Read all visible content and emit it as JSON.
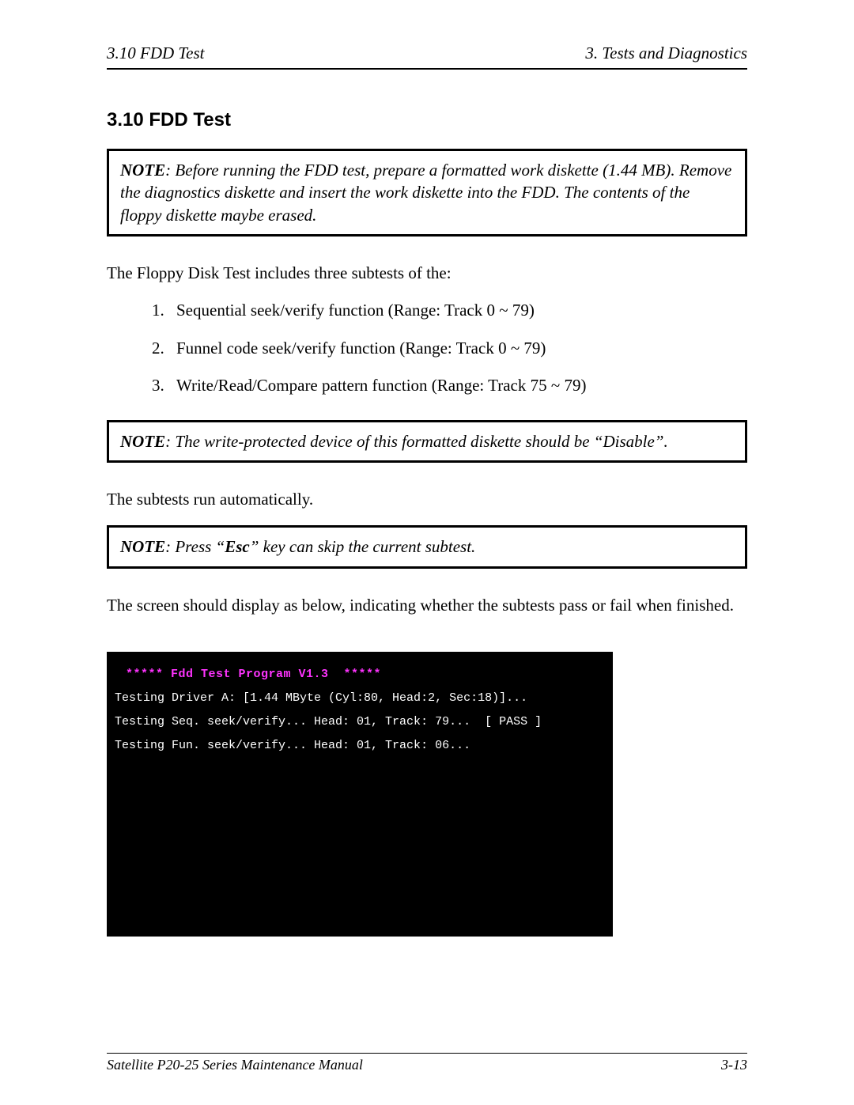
{
  "header": {
    "left": "3.10  FDD Test",
    "right": "3.  Tests and Diagnostics"
  },
  "heading": "3.10  FDD Test",
  "note1": {
    "label": "NOTE",
    "text": ":  Before running the FDD test, prepare a formatted work diskette (1.44 MB). Remove the diagnostics diskette and insert the work diskette into the FDD.  The contents of the floppy diskette maybe erased."
  },
  "intro": "The Floppy Disk Test includes three subtests of the:",
  "list": [
    "Sequential seek/verify function (Range: Track 0 ~ 79)",
    "Funnel code seek/verify function (Range: Track 0 ~ 79)",
    "Write/Read/Compare pattern function (Range: Track 75 ~ 79)"
  ],
  "note2": {
    "label": "NOTE",
    "text": ":  The write-protected device of this formatted diskette should be “Disable”."
  },
  "para_auto": "The subtests run automatically.",
  "note3": {
    "label": "NOTE",
    "before": ":  Press “",
    "esc": "Esc",
    "after": "” key can skip the current subtest."
  },
  "para_screen": "The screen should display as below, indicating whether the subtests pass or fail when finished.",
  "terminal": {
    "title": "***** Fdd Test Program V1.3  *****",
    "lines": [
      "Testing Driver A: [1.44 MByte (Cyl:80, Head:2, Sec:18)]...",
      "Testing Seq. seek/verify... Head: 01, Track: 79...  [ PASS ]",
      "Testing Fun. seek/verify... Head: 01, Track: 06..."
    ]
  },
  "footer": {
    "left": "Satellite P20-25 Series Maintenance Manual",
    "right": "3-13"
  }
}
